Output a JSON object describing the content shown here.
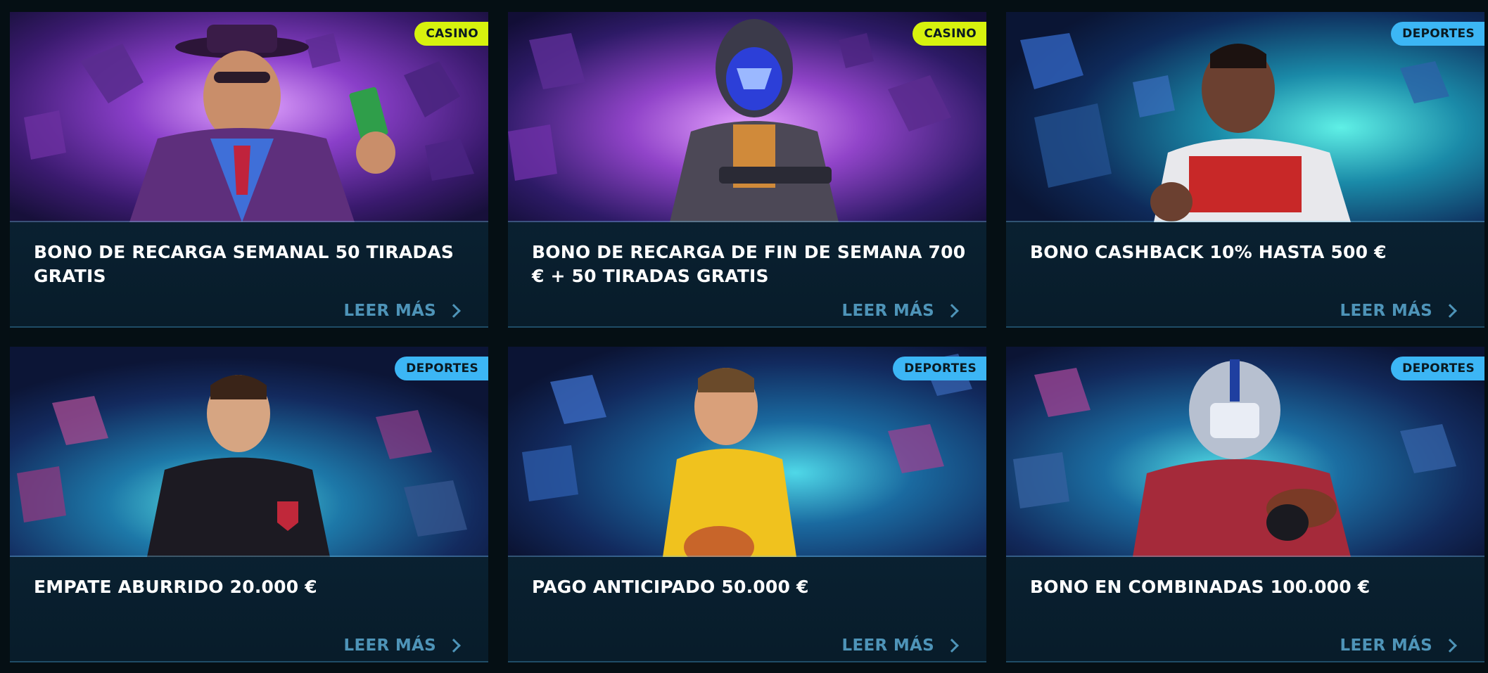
{
  "colors": {
    "page_bg": "#050f14",
    "card_bg": "#0a2233",
    "title": "#ffffff",
    "link": "#4e94b8",
    "badge_casino": "#d7f20e",
    "badge_deportes": "#3cb6f5"
  },
  "cards": [
    {
      "badge": "CASINO",
      "badge_type": "casino",
      "title": "BONO DE RECARGA SEMANAL 50 TIRADAS GRATIS",
      "link": "LEER MÁS",
      "image_icon": "cowboy-character-image"
    },
    {
      "badge": "CASINO",
      "badge_type": "casino",
      "title": "BONO DE RECARGA DE FIN DE SEMANA 700 € + 50 TIRADAS GRATIS",
      "link": "LEER MÁS",
      "image_icon": "space-warrior-image"
    },
    {
      "badge": "DEPORTES",
      "badge_type": "deportes",
      "title": "BONO CASHBACK 10% HASTA 500 €",
      "link": "LEER MÁS",
      "image_icon": "celebrating-footballer-image"
    },
    {
      "badge": "DEPORTES",
      "badge_type": "deportes",
      "title": "EMPATE ABURRIDO 20.000 €",
      "link": "LEER MÁS",
      "image_icon": "soccer-player-image"
    },
    {
      "badge": "DEPORTES",
      "badge_type": "deportes",
      "title": "PAGO ANTICIPADO 50.000 €",
      "link": "LEER MÁS",
      "image_icon": "basketball-player-image"
    },
    {
      "badge": "DEPORTES",
      "badge_type": "deportes",
      "title": "BONO EN COMBINADAS 100.000 €",
      "link": "LEER MÁS",
      "image_icon": "american-football-player-image"
    }
  ]
}
